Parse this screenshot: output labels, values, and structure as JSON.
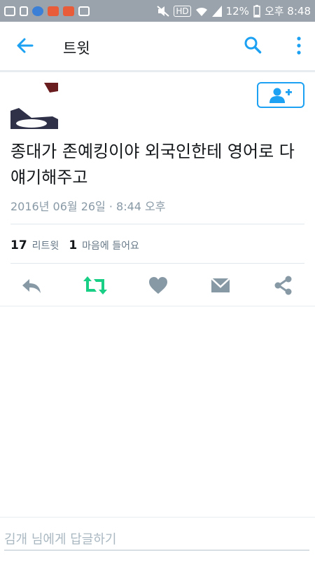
{
  "status_bar": {
    "wifi_icon": "wifi-icon",
    "hd_label": "HD",
    "battery": "12%",
    "time": "오후 8:48"
  },
  "app_bar": {
    "title": "트윗"
  },
  "tweet": {
    "text": "종대가 존예킹이야 외국인한테 영어로 다 얘기해주고",
    "timestamp": "2016년 06월 26일 · 8:44 오후"
  },
  "stats": {
    "retweets_count": "17",
    "retweets_label": "리트윗",
    "likes_count": "1",
    "likes_label": "마음에 들어요"
  },
  "colors": {
    "accent": "#1da1f2",
    "retweet_green": "#19cf86",
    "icon_gray": "#8899a6"
  },
  "reply": {
    "placeholder": "김개 님에게 답글하기"
  }
}
